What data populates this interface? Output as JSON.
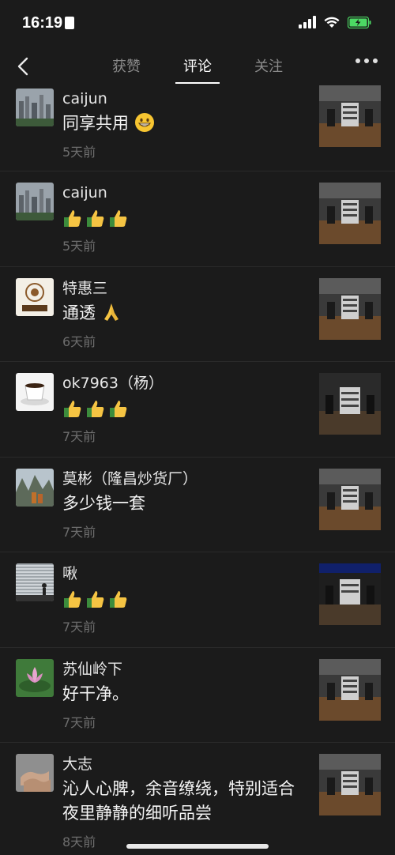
{
  "status": {
    "time": "16:19"
  },
  "nav": {
    "tabs": [
      {
        "label": "获赞"
      },
      {
        "label": "评论"
      },
      {
        "label": "关注"
      }
    ],
    "active_tab": "评论"
  },
  "comments": [
    {
      "name": "caijun",
      "text": "同享共用",
      "emoji": "grinning",
      "ago": "5天前"
    },
    {
      "name": "caijun",
      "text": "",
      "emoji": "thumbs-up x3",
      "ago": "5天前"
    },
    {
      "name": "特惠三",
      "text": "通透",
      "emoji": "praying-hands",
      "ago": "6天前"
    },
    {
      "name": "ok7963（杨）",
      "text": "",
      "emoji": "thumbs-up x3",
      "ago": "7天前"
    },
    {
      "name": "莫彬（隆昌炒货厂）",
      "text": "多少钱一套",
      "ago": "7天前"
    },
    {
      "name": "啾",
      "text": "",
      "emoji": "thumbs-up x3",
      "ago": "7天前"
    },
    {
      "name": "苏仙岭下",
      "text": "好干净。",
      "ago": "7天前"
    },
    {
      "name": "大志",
      "text": "沁人心脾，余音缭绕，特别适合夜里静静的细听品尝",
      "ago": "8天前"
    }
  ],
  "colors": {
    "background": "#1b1b1b",
    "primary_text": "#e8e8e8",
    "muted_text": "#6e6e6e"
  }
}
